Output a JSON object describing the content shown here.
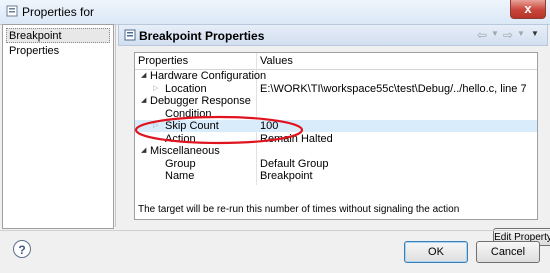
{
  "window": {
    "title": "Properties for",
    "close_label": "x"
  },
  "sidebar": {
    "items": [
      {
        "label": "Breakpoint Properties"
      }
    ]
  },
  "header": {
    "title": "Breakpoint Properties"
  },
  "table": {
    "columns": [
      "Properties",
      "Values"
    ],
    "rows": [
      {
        "level": 0,
        "expander": "expanded",
        "name": "Hardware Configuration",
        "value": ""
      },
      {
        "level": 1,
        "expander": "collapsed",
        "name": "Location",
        "value": "E:\\WORK\\TI\\workspace55c\\test\\Debug/../hello.c, line 7"
      },
      {
        "level": 0,
        "expander": "expanded",
        "name": "Debugger Response",
        "value": ""
      },
      {
        "level": 1,
        "expander": "none",
        "name": "Condition",
        "value": ""
      },
      {
        "level": 1,
        "expander": "collapsed",
        "name": "Skip Count",
        "value": "100",
        "selected": true
      },
      {
        "level": 1,
        "expander": "none",
        "name": "Action",
        "value": "Remain Halted"
      },
      {
        "level": 0,
        "expander": "expanded",
        "name": "Miscellaneous",
        "value": ""
      },
      {
        "level": 1,
        "expander": "none",
        "name": "Group",
        "value": "Default Group"
      },
      {
        "level": 1,
        "expander": "none",
        "name": "Name",
        "value": "Breakpoint"
      }
    ]
  },
  "description": "The target will be re-run this number of times without signaling the action",
  "buttons": {
    "edit_property": "Edit Property",
    "ok": "OK",
    "cancel": "Cancel",
    "help": "?"
  },
  "colors": {
    "annotation": "#e0141e",
    "selection": "#d9ecfb"
  }
}
